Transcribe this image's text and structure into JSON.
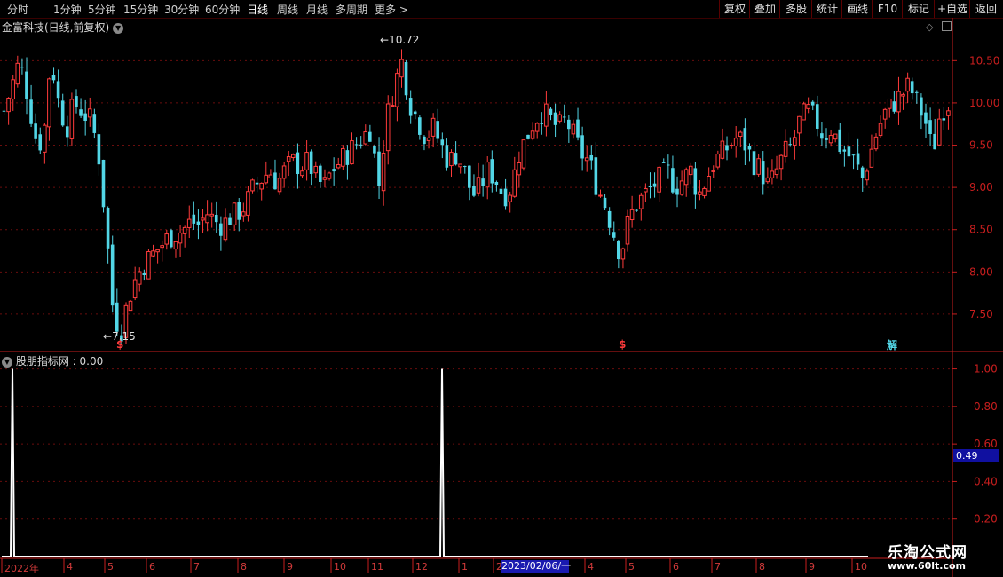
{
  "toolbar": {
    "periods": [
      "分时",
      "1分钟",
      "5分钟",
      "15分钟",
      "30分钟",
      "60分钟",
      "日线",
      "周线",
      "月线",
      "多周期",
      "更多 >"
    ],
    "active_period": "日线",
    "right_buttons": [
      "复权",
      "叠加",
      "多股",
      "统计",
      "画线",
      "F10",
      "标记",
      "+自选",
      "返回"
    ]
  },
  "price_panel": {
    "title": "金富科技(日线,前复权)",
    "high_label": "10.72",
    "low_label": "7.15",
    "signals": [
      "$",
      "$",
      "解"
    ]
  },
  "indicator_panel": {
    "title": "股朋指标网 : 0.00",
    "current_value": "0.49"
  },
  "x_axis": {
    "labels": [
      "2022年",
      "4",
      "5",
      "6",
      "7",
      "8",
      "9",
      "10",
      "11",
      "12",
      "1",
      "2",
      "4",
      "5",
      "6",
      "7",
      "8",
      "9",
      "10"
    ],
    "cursor_date": "2023/02/06/一"
  },
  "watermark": {
    "line1": "乐淘公式网",
    "line2": "www.60lt.com"
  },
  "colors": {
    "up": "#ff3b3b",
    "down": "#52d6e6",
    "axis": "#c81e1e",
    "grid": "#6a0d0d"
  },
  "chart_data": [
    {
      "type": "candlestick",
      "title": "金富科技(日线,前复权)",
      "ylim": [
        7.1,
        10.85
      ],
      "y_ticks": [
        7.5,
        8.0,
        8.5,
        9.0,
        9.5,
        10.0,
        10.5
      ],
      "annotations": {
        "max": 10.72,
        "min": 7.15
      },
      "close_path": [
        9.9,
        10.2,
        10.5,
        10.1,
        9.6,
        9.5,
        10.55,
        10.0,
        9.7,
        10.0,
        9.9,
        9.8,
        9.5,
        8.6,
        7.5,
        7.3,
        7.7,
        7.95,
        8.1,
        8.2,
        8.3,
        8.4,
        8.45,
        8.5,
        8.6,
        8.55,
        8.7,
        8.6,
        8.55,
        8.65,
        8.7,
        8.8,
        9.0,
        9.1,
        9.2,
        9.05,
        9.2,
        9.3,
        9.25,
        9.3,
        9.1,
        9.0,
        9.2,
        9.3,
        9.4,
        9.5,
        9.6,
        9.7,
        9.0,
        9.8,
        10.2,
        10.5,
        10.0,
        9.8,
        9.6,
        9.7,
        9.5,
        9.3,
        9.4,
        9.2,
        8.9,
        9.0,
        9.2,
        9.1,
        8.9,
        9.0,
        9.4,
        9.6,
        9.8,
        9.9,
        9.8,
        9.7,
        9.8,
        9.6,
        9.4,
        9.3,
        9.0,
        8.8,
        8.5,
        8.2,
        8.6,
        8.8,
        8.9,
        9.0,
        9.1,
        9.2,
        9.0,
        9.1,
        9.2,
        8.9,
        9.1,
        9.3,
        9.4,
        9.5,
        9.6,
        9.5,
        9.3,
        9.2,
        9.0,
        9.2,
        9.4,
        9.5,
        9.8,
        9.9,
        9.8,
        9.6,
        9.7,
        9.5,
        9.4,
        9.3,
        9.1,
        9.4,
        9.7,
        9.9,
        10.0,
        10.1,
        10.2,
        10.0,
        9.8,
        9.4,
        9.9,
        10.0
      ]
    },
    {
      "type": "line",
      "title": "股朋指标网",
      "ylim": [
        0,
        1.05
      ],
      "y_ticks": [
        0.2,
        0.4,
        0.6,
        0.8,
        1.0
      ],
      "spikes": [
        {
          "date": "2022年1月初",
          "value": 1.0
        },
        {
          "date": "2023年1月初",
          "value": 1.0
        }
      ],
      "base_value": 0
    }
  ]
}
